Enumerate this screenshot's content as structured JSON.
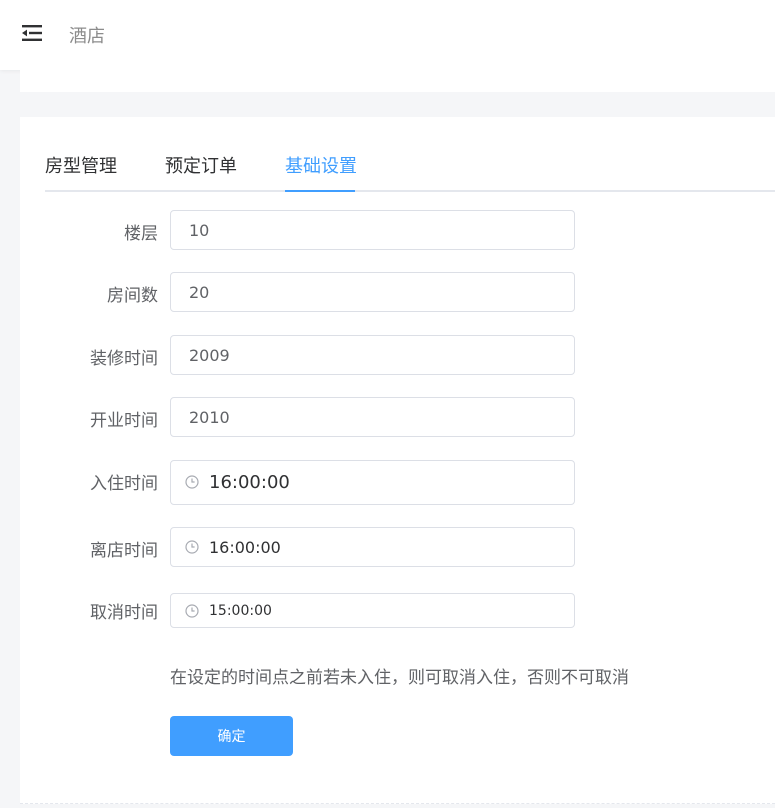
{
  "header": {
    "title": "酒店",
    "menu_icon": "menu-fold-icon"
  },
  "tabs": [
    {
      "label": "房型管理",
      "active": false
    },
    {
      "label": "预定订单",
      "active": false
    },
    {
      "label": "基础设置",
      "active": true
    }
  ],
  "form": {
    "floor": {
      "label": "楼层",
      "value": "10"
    },
    "rooms": {
      "label": "房间数",
      "value": "20"
    },
    "renovation": {
      "label": "装修时间",
      "value": "2009"
    },
    "opening": {
      "label": "开业时间",
      "value": "2010"
    },
    "checkin": {
      "label": "入住时间",
      "value": "16:00:00",
      "icon": "clock-icon"
    },
    "checkout": {
      "label": "离店时间",
      "value": "16:00:00",
      "icon": "clock-icon"
    },
    "cancel": {
      "label": "取消时间",
      "value": "15:00:00",
      "icon": "clock-icon"
    },
    "hint": "在设定的时间点之前若未入住，则可取消入住，否则不可取消",
    "submit_label": "确定"
  },
  "colors": {
    "accent": "#409eff",
    "border": "#dcdfe6",
    "background": "#f5f6f8"
  }
}
